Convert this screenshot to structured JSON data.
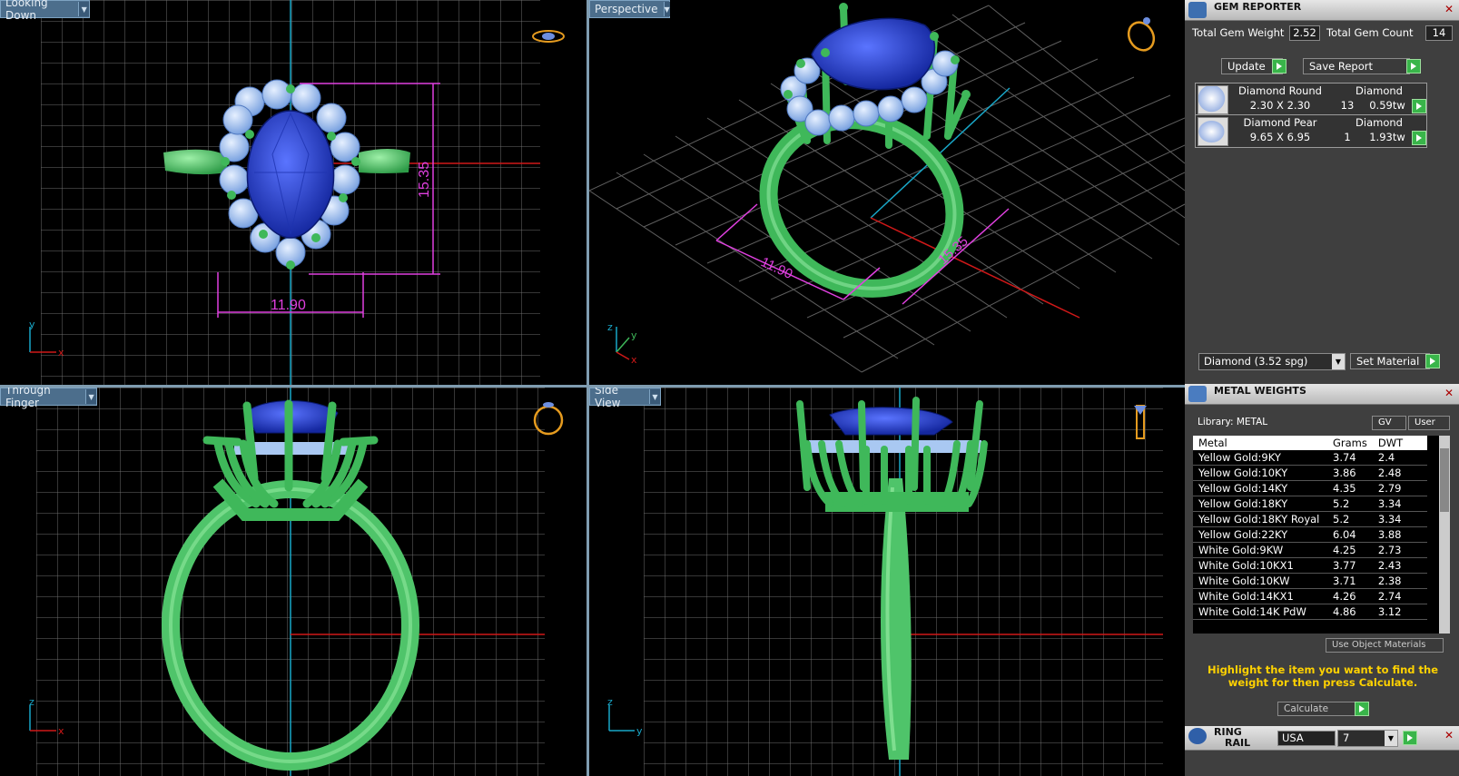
{
  "viewports": {
    "top_left": {
      "label": "Looking Down",
      "dim_h": "11.90",
      "dim_v": "15.35",
      "axes": [
        "y",
        "x"
      ]
    },
    "top_right": {
      "label": "Perspective",
      "dim_a": "11.90",
      "dim_b": "15.35",
      "axes": [
        "z",
        "y",
        "x"
      ]
    },
    "bottom_left": {
      "label": "Through Finger",
      "axes": [
        "z",
        "x"
      ]
    },
    "bottom_right": {
      "label": "Side View",
      "axes": [
        "z",
        "y"
      ]
    }
  },
  "gem_reporter": {
    "title": "GEM REPORTER",
    "total_weight_label": "Total Gem Weight",
    "total_weight": "2.52",
    "total_count_label": "Total Gem Count",
    "total_count": "14",
    "update_label": "Update",
    "save_report_label": "Save Report",
    "gems": [
      {
        "name": "Diamond Round",
        "type": "Diamond",
        "size": "2.30 X 2.30",
        "count": "13",
        "weight": "0.59tw"
      },
      {
        "name": "Diamond Pear",
        "type": "Diamond",
        "size": "9.65 X 6.95",
        "count": "1",
        "weight": "1.93tw"
      }
    ],
    "material_select": "Diamond   (3.52 spg)",
    "set_material_label": "Set Material"
  },
  "metal_weights": {
    "title": "METAL WEIGHTS",
    "library_label": "Library: METAL",
    "gv_label": "GV",
    "user_label": "User",
    "columns": [
      "Metal",
      "Grams",
      "DWT"
    ],
    "rows": [
      [
        "Yellow Gold:9KY",
        "3.74",
        "2.4"
      ],
      [
        "Yellow Gold:10KY",
        "3.86",
        "2.48"
      ],
      [
        "Yellow Gold:14KY",
        "4.35",
        "2.79"
      ],
      [
        "Yellow Gold:18KY",
        "5.2",
        "3.34"
      ],
      [
        "Yellow Gold:18KY Royal",
        "5.2",
        "3.34"
      ],
      [
        "Yellow Gold:22KY",
        "6.04",
        "3.88"
      ],
      [
        "White Gold:9KW",
        "4.25",
        "2.73"
      ],
      [
        "White Gold:10KX1",
        "3.77",
        "2.43"
      ],
      [
        "White Gold:10KW",
        "3.71",
        "2.38"
      ],
      [
        "White Gold:14KX1",
        "4.26",
        "2.74"
      ],
      [
        "White Gold:14K PdW",
        "4.86",
        "3.12"
      ]
    ],
    "use_object_materials_label": "Use Object Materials",
    "note": "Highlight the item you want to find the weight for then press Calculate.",
    "calculate_label": "Calculate"
  },
  "ring_rail": {
    "title_line1": "RING",
    "title_line2": "RAIL",
    "region": "USA",
    "size": "7"
  },
  "colors": {
    "metal_green": "#4fc46a",
    "sapphire": "#2a3fc0",
    "diamond": "#a9c8f2",
    "dimension": "#e040e0",
    "axis_red": "#d01818",
    "axis_cyan": "#19a7c8",
    "accent_yellow": "#ffd200"
  }
}
